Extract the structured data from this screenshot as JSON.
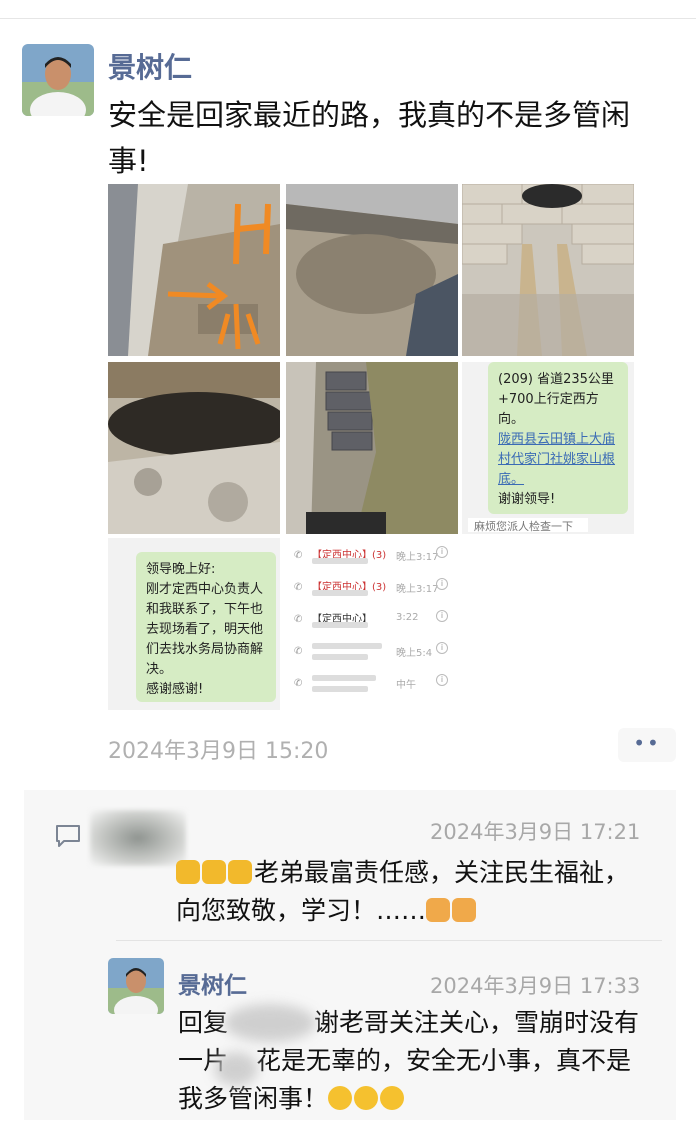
{
  "post": {
    "author": "景树仁",
    "text": "安全是回家最近的路，我真的不是多管闲事!",
    "timestamp": "2024年3月9日 15:20",
    "more_label": "••"
  },
  "screenshots": {
    "tile6_lines": [
      "(209) 省道235公里+700上行定西方向。",
      "陇西县云田镇上大庙村代家门社姚家山根底。",
      "谢谢领导!"
    ],
    "tile6_strip": "麻烦您派人检查一下",
    "tile7_lines": [
      "领导晚上好:",
      "刚才定西中心负责人和我联系了，下午也去现场看了，明天他们去找水务局协商解决。",
      "感谢感谢!"
    ],
    "call_list": [
      {
        "name": "【定西中心】(3)",
        "time": "晚上3:17",
        "info": "i"
      },
      {
        "name": "【定西中心】(3)",
        "time": "晚上3:17",
        "info": "i"
      },
      {
        "name": "【定西中心】",
        "time": "3:22",
        "info": "i"
      },
      {
        "name": "",
        "time": "晚上5:4",
        "info": "i"
      },
      {
        "name": "",
        "time": "中午",
        "info": "i"
      }
    ]
  },
  "comment1": {
    "time": "2024年3月9日 17:21",
    "text": "老弟最富责任感，关注民生福祉，向您致敬，学习！……"
  },
  "comment2": {
    "author": "景树仁",
    "time": "2024年3月9日 17:33",
    "text_prefix": "回复",
    "text_part1": "谢老哥关注关心，雪崩时没有一片",
    "text_part2": "花是无辜的，安全无小事，真不是我多管闲事！"
  }
}
